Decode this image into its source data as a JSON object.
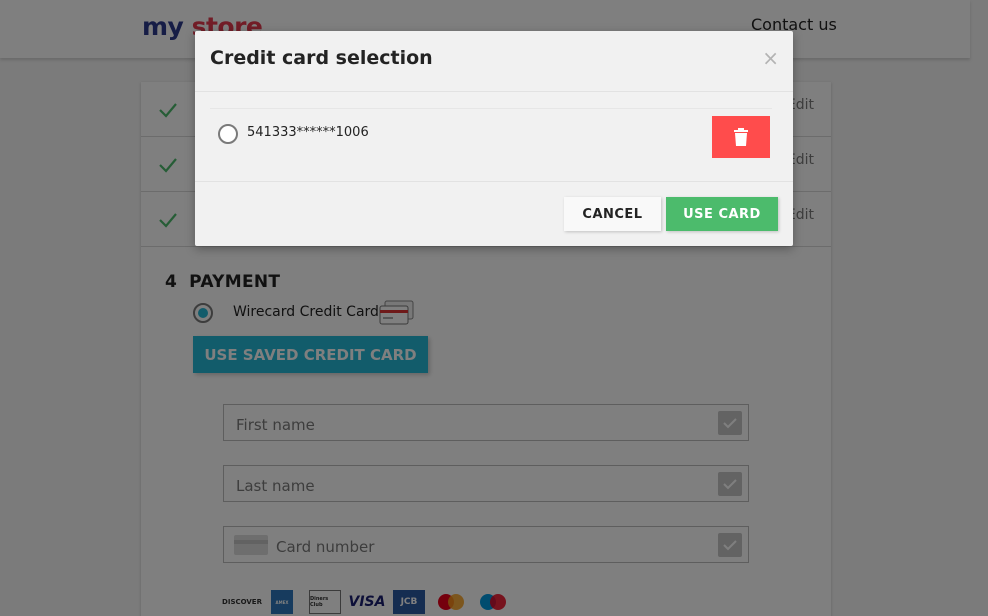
{
  "header": {
    "logo_part1": "my",
    "logo_part2": "store",
    "contact": "Contact us"
  },
  "steps": [
    {
      "edit": "Edit"
    },
    {
      "edit": "Edit"
    },
    {
      "edit": "Edit"
    }
  ],
  "payment": {
    "step_number": "4",
    "title": "PAYMENT",
    "method_label": "Wirecard Credit Card",
    "use_saved_label": "USE SAVED CREDIT CARD",
    "fields": {
      "first_name": "First name",
      "last_name": "Last name",
      "card_number": "Card number"
    },
    "brands": [
      "DISCOVER",
      "AMEX",
      "Diners Club",
      "VISA",
      "JCB",
      "mastercard",
      "maestro"
    ]
  },
  "modal": {
    "title": "Credit card selection",
    "close": "×",
    "card_number": "541333******1006",
    "cancel_label": "CANCEL",
    "use_label": "USE CARD"
  },
  "colors": {
    "accent": "#25b9d7",
    "success": "#4cbb6c",
    "danger": "#ff4c4c"
  }
}
